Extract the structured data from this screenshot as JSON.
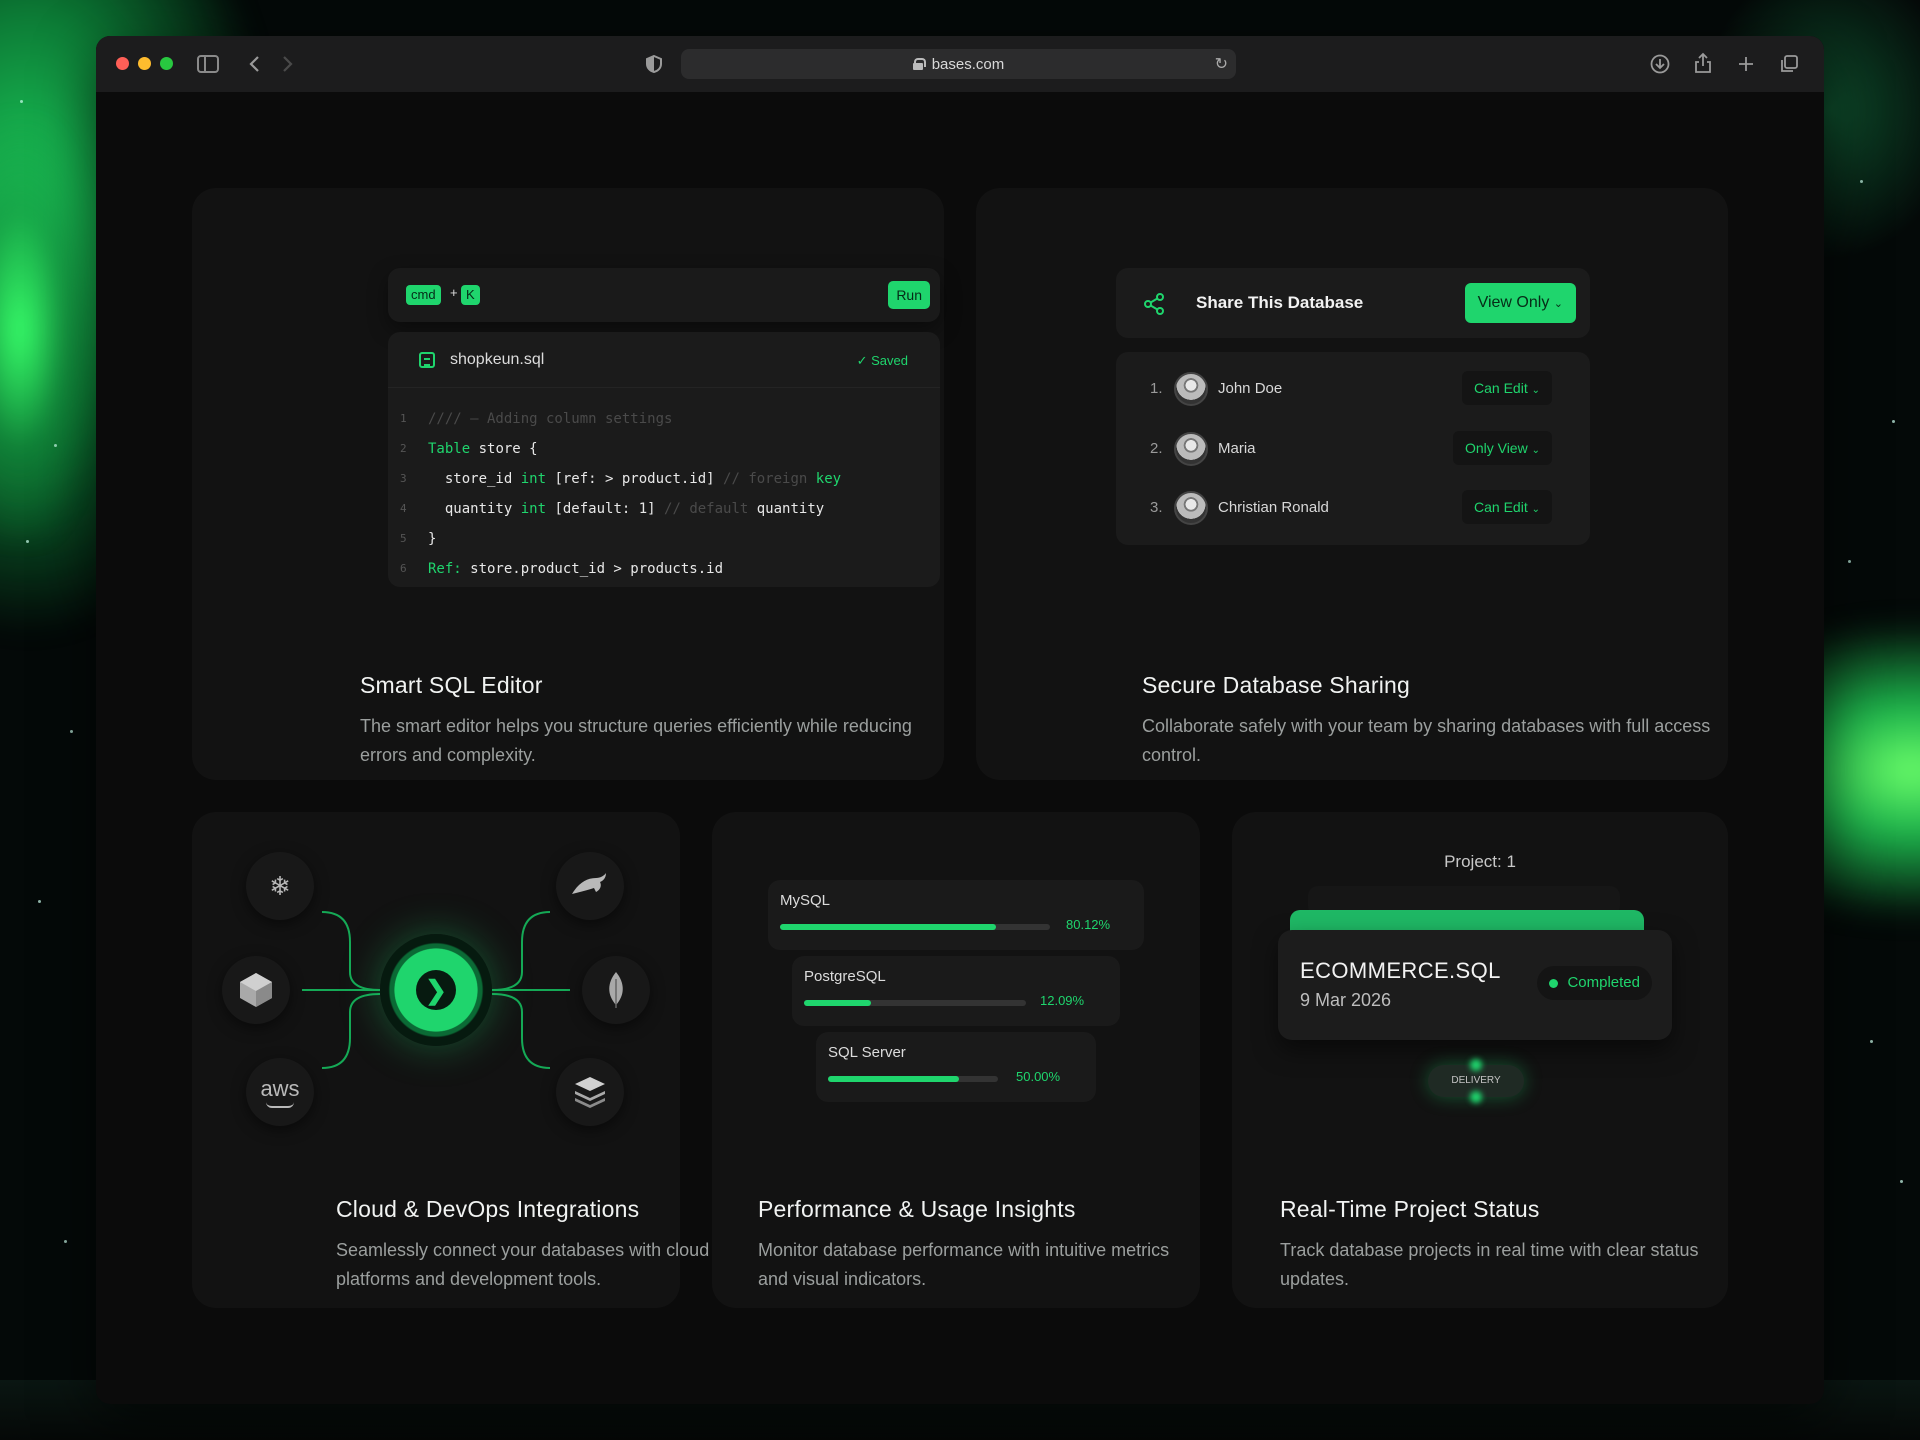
{
  "browser": {
    "url": "bases.com"
  },
  "sql_editor": {
    "kbd_cmd": "cmd",
    "kbd_plus": "+",
    "kbd_key": "K",
    "run_label": "Run",
    "file_name": "shopkeun.sql",
    "saved_label": "Saved",
    "line_numbers": [
      "1",
      "2",
      "3",
      "4",
      "5",
      "6"
    ],
    "title": "Smart SQL Editor",
    "description": "The smart editor helps you structure queries efficiently while reducing errors and complexity."
  },
  "sharing": {
    "header": "Share This Database",
    "view_button": "View Only",
    "users": [
      {
        "index": "1.",
        "name": "John Doe",
        "permission": "Can Edit"
      },
      {
        "index": "2.",
        "name": "Maria",
        "permission": "Only View"
      },
      {
        "index": "3.",
        "name": "Christian Ronald",
        "permission": "Can Edit"
      }
    ],
    "title": "Secure Database Sharing",
    "description": "Collaborate safely with your team by sharing databases with full access control."
  },
  "integrations": {
    "aws_label": "aws",
    "title": "Cloud & DevOps Integrations",
    "description": "Seamlessly connect your databases with cloud platforms and development tools.",
    "icons": [
      "snowflake-icon",
      "mysql-dolphin-icon",
      "cube-icon",
      "mongodb-leaf-icon",
      "aws-icon",
      "layers-icon",
      "bases-logo-icon"
    ]
  },
  "performance": {
    "items": [
      {
        "name": "MySQL",
        "percent_label": "80.12%",
        "value": 80.12
      },
      {
        "name": "PostgreSQL",
        "percent_label": "12.09%",
        "value": 30
      },
      {
        "name": "SQL Server",
        "percent_label": "50.00%",
        "value": 77
      }
    ],
    "title": "Performance & Usage Insights",
    "description": "Monitor database performance with intuitive metrics and visual indicators."
  },
  "project": {
    "label": "Project: 1",
    "file": "ECOMMERCE.SQL",
    "date": "9 Mar 2026",
    "status": "Completed",
    "stage": "DELIVERY",
    "title": "Real-Time Project Status",
    "description": "Track database projects in real time with clear status updates."
  },
  "colors": {
    "accent": "#1fd56d",
    "card": "#121212",
    "window": "#0b0b0b"
  }
}
